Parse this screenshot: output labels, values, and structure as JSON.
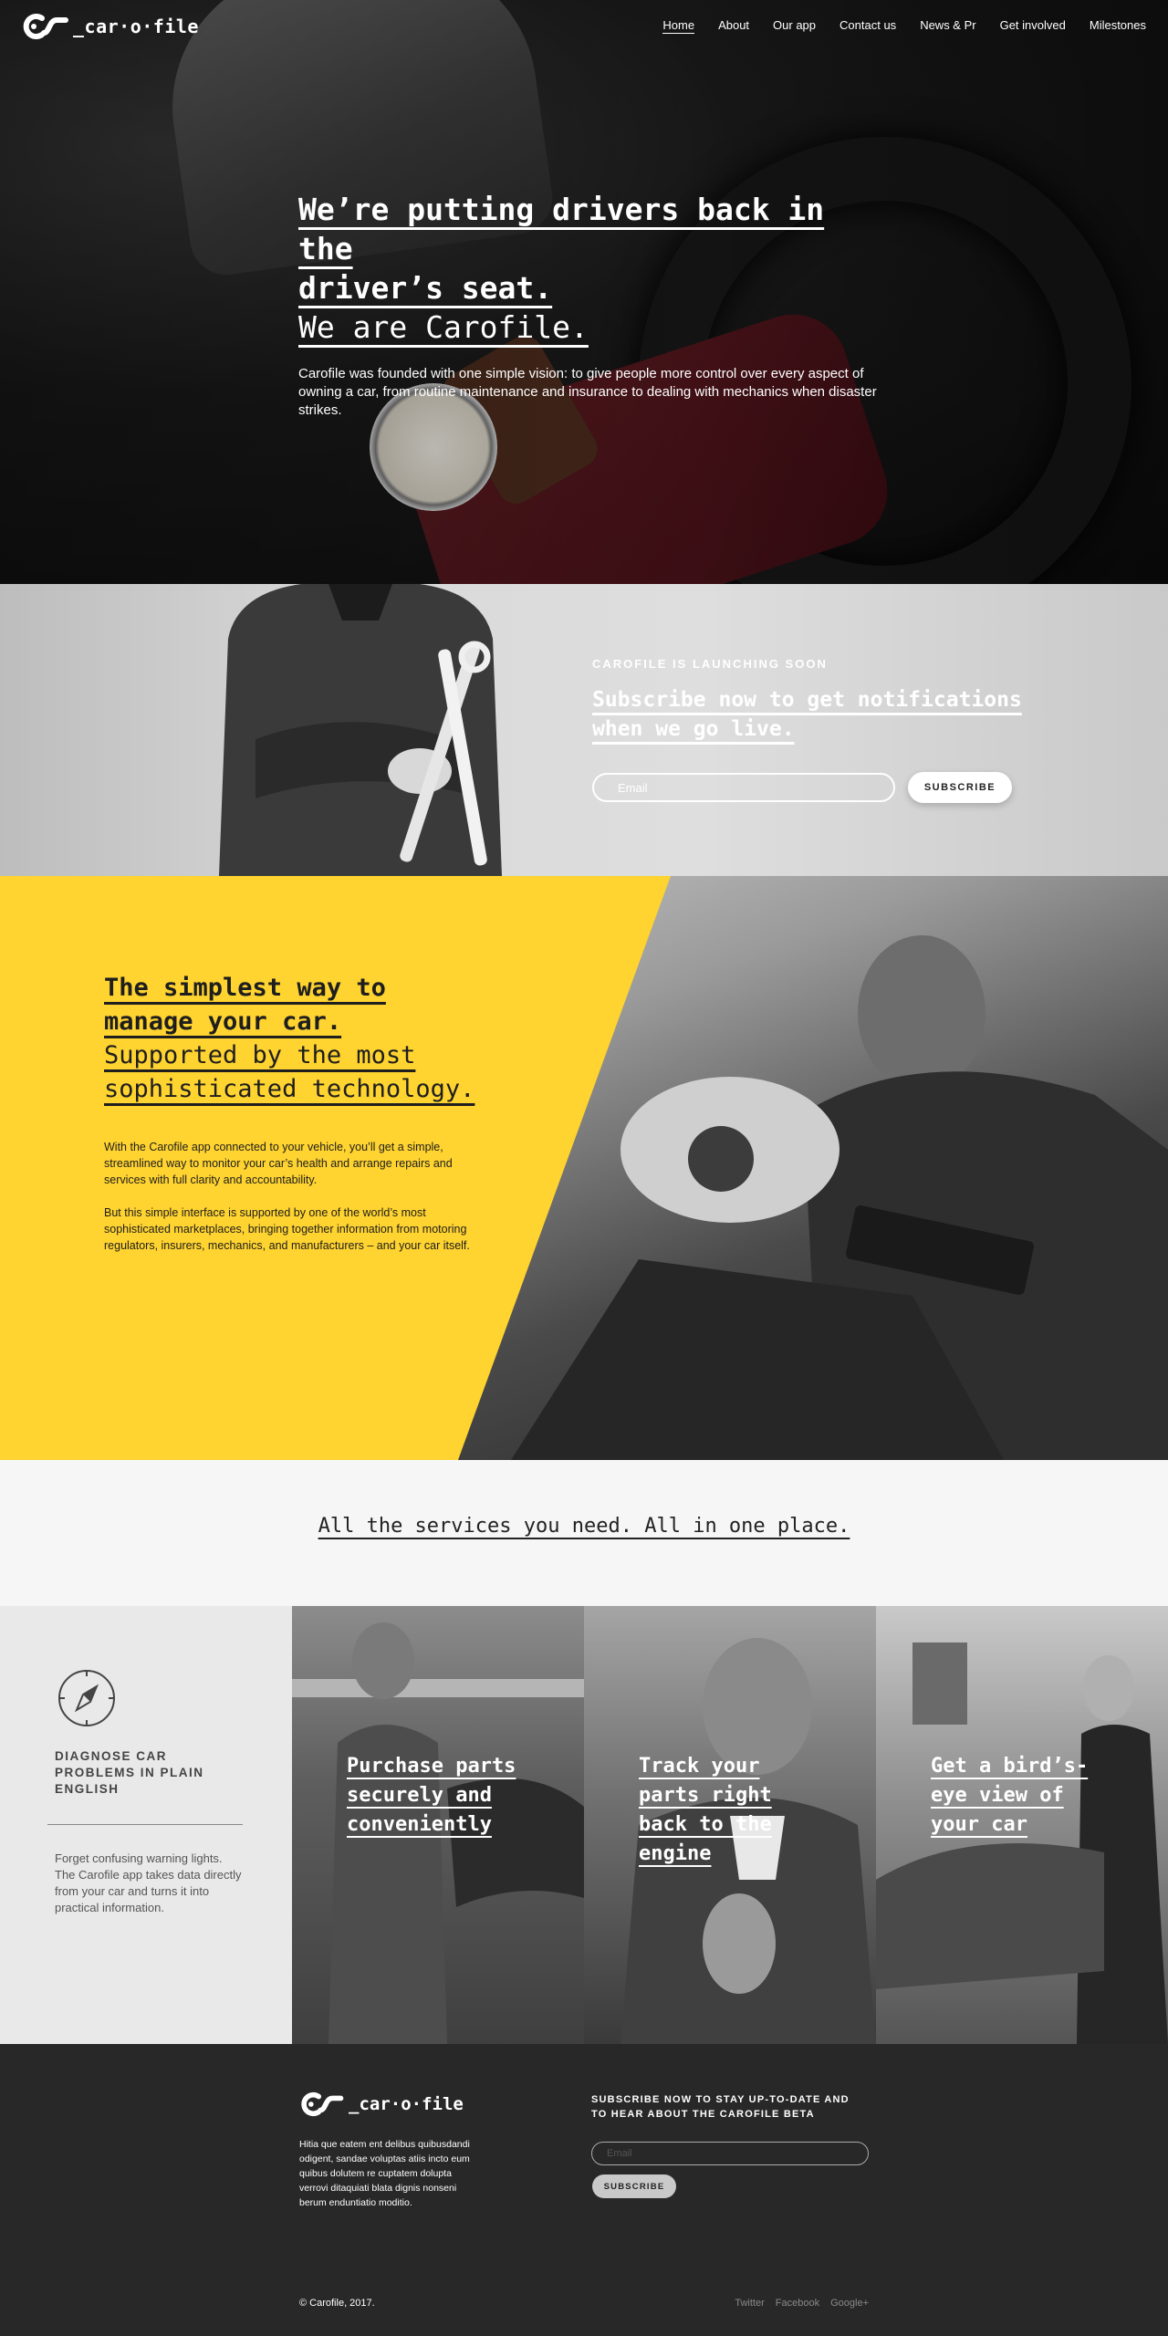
{
  "brand": {
    "name": "_car·o·file"
  },
  "nav": {
    "items": [
      {
        "label": "Home",
        "active": true
      },
      {
        "label": "About"
      },
      {
        "label": "Our app"
      },
      {
        "label": "Contact us"
      },
      {
        "label": "News & Pr"
      },
      {
        "label": "Get involved"
      },
      {
        "label": "Milestones"
      }
    ]
  },
  "hero": {
    "headline_line1": "We’re putting drivers back in the",
    "headline_line2": "driver’s seat.",
    "headline_line3": "We are Carofile.",
    "body": "Carofile was founded with one simple vision: to give people more control over every aspect of owning a car, from routine maintenance and insurance to dealing with mechanics when disaster strikes."
  },
  "launch": {
    "kicker": "CAROFILE IS LAUNCHING SOON",
    "heading_line1": "Subscribe now to get notifications",
    "heading_line2": "when we go live.",
    "email_placeholder": "Email",
    "button_label": "SUBSCRIBE"
  },
  "simple": {
    "heading_line1": "The simplest way to",
    "heading_line2": "manage your car.",
    "heading_line3": "Supported by the most",
    "heading_line4": "sophisticated technology.",
    "paragraph1": "With the Carofile app connected to your vehicle, you’ll get a simple, streamlined way to monitor your car’s health and arrange repairs and services with full clarity and accountability.",
    "paragraph2": "But this simple interface is supported by one of the world’s most sophisticated marketplaces, bringing together information from motoring regulators, insurers, mechanics, and manufacturers – and your car itself."
  },
  "services": {
    "heading": "All the services you need. All in one place.",
    "diagnose": {
      "icon": "compass-icon",
      "title": "DIAGNOSE CAR PROBLEMS IN PLAIN ENGLISH",
      "text": "Forget confusing warning lights. The Carofile app takes data directly from your car and turns it into practical information."
    },
    "cards": [
      {
        "title": "Purchase parts securely and conveniently"
      },
      {
        "title": "Track your parts right back to the engine"
      },
      {
        "title": "Get a bird’s-eye view of your car"
      }
    ]
  },
  "footer": {
    "about": "Hitia que eatem ent delibus quibusdandi odigent, sandae voluptas atiis incto eum quibus dolutem re cuptatem dolupta verrovi ditaquiati blata dignis nonseni berum enduntiatio moditio.",
    "subscribe_title": "SUBSCRIBE NOW TO STAY UP-TO-DATE AND TO HEAR ABOUT THE CAROFILE BETA",
    "email_placeholder": "Email",
    "button_label": "SUBSCRIBE",
    "copyright": "© Carofile, 2017.",
    "social": [
      "Twitter",
      "Facebook",
      "Google+"
    ]
  },
  "colors": {
    "accent_yellow": "#ffd330",
    "footer_bg": "#282828"
  }
}
